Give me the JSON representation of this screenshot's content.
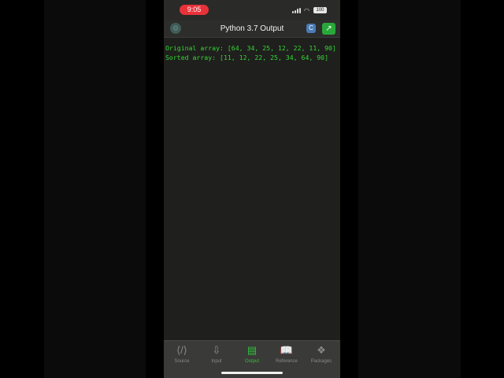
{
  "status_bar": {
    "time": "9:05",
    "battery": "100"
  },
  "nav_bar": {
    "title": "Python 3.7  Output"
  },
  "output": {
    "text": "Original array: [64, 34, 25, 12, 22, 11, 90]\nSorted array: [11, 12, 22, 25, 34, 64, 90]"
  },
  "tabs": [
    {
      "label": "Source",
      "icon": "source-code-icon",
      "active": false
    },
    {
      "label": "Input",
      "icon": "download-tray-icon",
      "active": false
    },
    {
      "label": "Output",
      "icon": "clipboard-icon",
      "active": true
    },
    {
      "label": "Reference",
      "icon": "open-book-icon",
      "active": false
    },
    {
      "label": "Packages",
      "icon": "dropbox-icon",
      "active": false
    }
  ],
  "colors": {
    "accent": "#2fc23a",
    "output_text": "#35d735",
    "recording_pill": "#e8323a"
  }
}
